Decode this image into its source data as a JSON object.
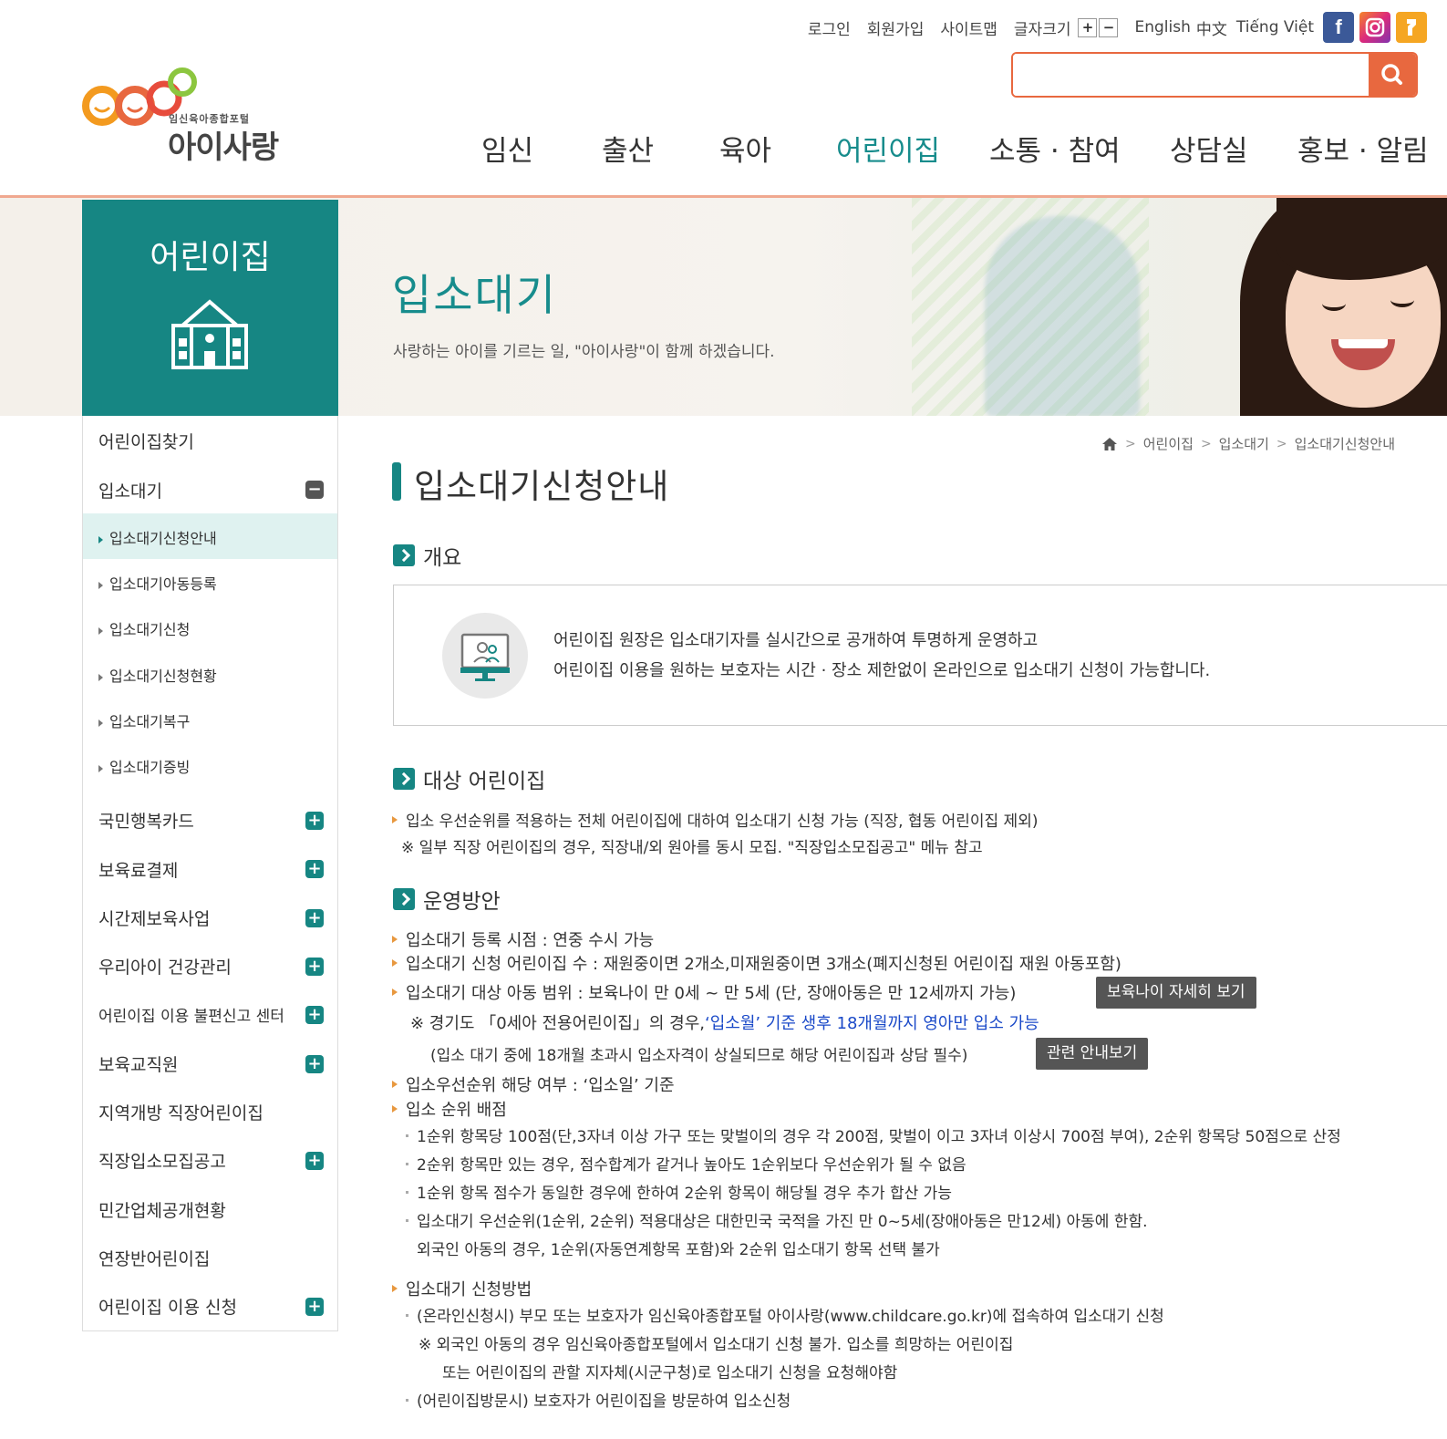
{
  "utility": {
    "login": "로그인",
    "join": "회원가입",
    "sitemap": "사이트맵",
    "font_size_label": "글자크기",
    "font_plus": "+",
    "font_minus": "−",
    "lang_en": "English",
    "lang_zh": "中文",
    "lang_vi": "Tiếng Việt",
    "sns": [
      "facebook-icon",
      "instagram-icon",
      "kakaostory-icon"
    ]
  },
  "logo": {
    "sub": "임신육아종합포털",
    "main": "아이사랑"
  },
  "search": {
    "placeholder": ""
  },
  "gnb": [
    "임신",
    "출산",
    "육아",
    "어린이집",
    "소통 · 참여",
    "상담실",
    "홍보 · 알림"
  ],
  "gnb_active": "어린이집",
  "visual": {
    "section": "어린이집",
    "title": "입소대기",
    "subtitle": "사랑하는 아이를 기르는 일, \"아이사랑\"이 함께 하겠습니다."
  },
  "lnb": {
    "items": [
      {
        "label": "어린이집찾기",
        "toggle": ""
      },
      {
        "label": "입소대기",
        "toggle": "−"
      },
      {
        "label": "국민행복카드",
        "toggle": "+"
      },
      {
        "label": "보육료결제",
        "toggle": "+"
      },
      {
        "label": "시간제보육사업",
        "toggle": "+"
      },
      {
        "label": "우리아이 건강관리",
        "toggle": "+"
      },
      {
        "label": "어린이집 이용 불편신고 센터",
        "toggle": "+"
      },
      {
        "label": "보육교직원",
        "toggle": "+"
      },
      {
        "label": "지역개방 직장어린이집",
        "toggle": ""
      },
      {
        "label": "직장입소모집공고",
        "toggle": "+"
      },
      {
        "label": "민간업체공개현황",
        "toggle": ""
      },
      {
        "label": "연장반어린이집",
        "toggle": ""
      },
      {
        "label": "어린이집 이용 신청",
        "toggle": "+"
      }
    ],
    "sub": [
      "입소대기신청안내",
      "입소대기아동등록",
      "입소대기신청",
      "입소대기신청현황",
      "입소대기복구",
      "입소대기증빙"
    ]
  },
  "breadcrumb": [
    "어린이집",
    "입소대기",
    "입소대기신청안내"
  ],
  "page_title": "입소대기신청안내",
  "overview": {
    "title": "개요",
    "line1": "어린이집 원장은 입소대기자를 실시간으로 공개하여 투명하게 운영하고",
    "line2": "어린이집 이용을 원하는 보호자는 시간 · 장소 제한없이 온라인으로 입소대기 신청이 가능합니다."
  },
  "target": {
    "title": "대상 어린이집",
    "line1": "입소 우선순위를 적용하는 전체 어린이집에 대하여 입소대기 신청 가능 (직장, 협동 어린이집 제외)",
    "note": "※ 일부 직장 어린이집의 경우, 직장내/외 원아를 동시 모집. \"직장입소모집공고\" 메뉴 참고"
  },
  "operation": {
    "title": "운영방안",
    "l1": "입소대기 등록 시점 : 연중 수시 가능",
    "l2": "입소대기 신청 어린이집 수 : 재원중이면 2개소,미재원중이면 3개소(폐지신청된 어린이집 재원 아동포함)",
    "l3": "입소대기 대상 아동 범위 : 보육나이 만 0세 ~ 만 5세 (단, 장애아동은 만 12세까지 가능)",
    "btn_age": "보육나이 자세히 보기",
    "l4a": "※ 경기도 「0세아 전용어린이집」의 경우,",
    "l4b": "‘입소월’ 기준 생후 18개월까지 영아만 입소 가능",
    "l5": "(입소 대기 중에 18개월 초과시 입소자격이 상실되므로 해당 어린이집과 상담 필수)",
    "btn_related": "관련 안내보기",
    "l6": "입소우선순위 해당 여부 : ‘입소일’ 기준",
    "l7": "입소 순위 배점",
    "s1": "1순위 항목당 100점(단,3자녀 이상 가구 또는 맞벌이의 경우 각 200점, 맞벌이 이고 3자녀 이상시 700점 부여), 2순위 항목당 50점으로 산정",
    "s2": "2순위 항목만 있는 경우, 점수합계가 같거나 높아도 1순위보다 우선순위가 될 수 없음",
    "s3": "1순위 항목 점수가 동일한 경우에 한하여 2순위 항목이 해당될 경우 추가 합산 가능",
    "s4": "입소대기 우선순위(1순위, 2순위) 적용대상은 대한민국 국적을 가진 만 0~5세(장애아동은 만12세) 아동에 한함.",
    "s4b": "외국인 아동의 경우, 1순위(자동연계항목 포함)와 2순위 입소대기 항목 선택 불가",
    "l8": "입소대기 신청방법",
    "m1": "(온라인신청시) 부모 또는 보호자가 임신육아종합포털 아이사랑(www.childcare.go.kr)에 접속하여 입소대기 신청",
    "m2": "※ 외국인 아동의 경우 임신육아종합포털에서 입소대기 신청 불가. 입소를 희망하는 어린이집",
    "m3": "또는 어린이집의 관할 지자체(시군구청)로 입소대기 신청을 요청해야함",
    "m4": "(어린이집방문시) 보호자가 어린이집을 방문하여 입소신청"
  },
  "colors": {
    "teal": "#168683",
    "orange": "#e8683f",
    "link_blue": "#1a49c8"
  }
}
